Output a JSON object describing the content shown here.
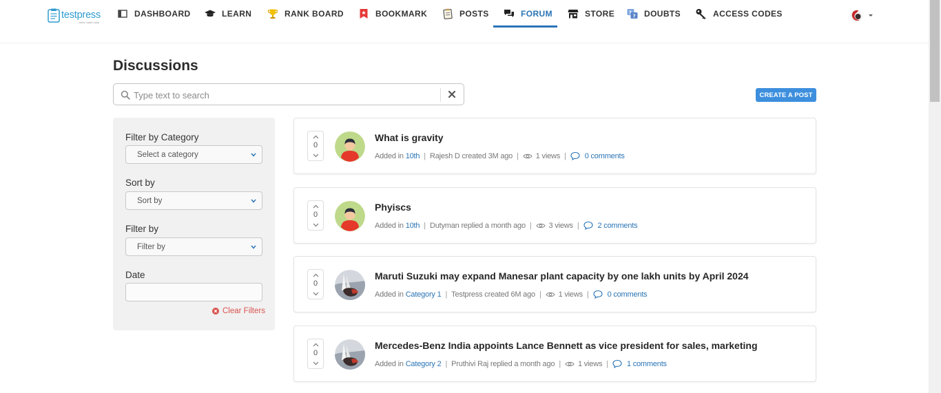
{
  "brand": {
    "name": "testpress",
    "tagline": "tests made easy"
  },
  "nav": {
    "items": [
      {
        "label": "DASHBOARD",
        "icon": "dashboard-icon"
      },
      {
        "label": "LEARN",
        "icon": "graduation-cap-icon"
      },
      {
        "label": "RANK BOARD",
        "icon": "trophy-icon"
      },
      {
        "label": "BOOKMARK",
        "icon": "bookmark-icon"
      },
      {
        "label": "POSTS",
        "icon": "posts-icon"
      },
      {
        "label": "FORUM",
        "icon": "forum-icon",
        "active": true
      },
      {
        "label": "STORE",
        "icon": "store-icon"
      },
      {
        "label": "DOUBTS",
        "icon": "doubts-icon"
      },
      {
        "label": "ACCESS CODES",
        "icon": "key-icon"
      }
    ],
    "active_color": "#2a74b5"
  },
  "page": {
    "title": "Discussions"
  },
  "search": {
    "placeholder": "Type text to search",
    "value": ""
  },
  "create_post": {
    "label": "CREATE A POST",
    "color": "#3d8fde"
  },
  "filters": {
    "category_label": "Filter by Category",
    "category_placeholder": "Select a category",
    "sort_label": "Sort by",
    "sort_placeholder": "Sort by",
    "filter_label": "Filter by",
    "filter_placeholder": "Filter by",
    "date_label": "Date",
    "date_value": "",
    "clear_label": "Clear Filters"
  },
  "posts": [
    {
      "title": "What is gravity",
      "votes": "0",
      "added_in": "Added in",
      "category": "10th",
      "activity": "Rajesh D created 3M ago",
      "views": "1 views",
      "comments": "0 comments",
      "avatar": "default-avatar"
    },
    {
      "title": "Phyiscs",
      "votes": "0",
      "added_in": "Added in",
      "category": "10th",
      "activity": "Dutyman replied a month ago",
      "views": "3 views",
      "comments": "2 comments",
      "avatar": "default-avatar"
    },
    {
      "title": "Maruti Suzuki may expand Manesar plant capacity by one lakh units by April 2024",
      "votes": "0",
      "added_in": "Added in",
      "category": "Category 1",
      "activity": "Testpress created 6M ago",
      "views": "1 views",
      "comments": "0 comments",
      "avatar": "photo-avatar"
    },
    {
      "title": "Mercedes-Benz India appoints Lance Bennett as vice president for sales, marketing",
      "votes": "0",
      "added_in": "Added in",
      "category": "Category 2",
      "activity": "Pruthivi Raj replied a month ago",
      "views": "1 views",
      "comments": "1 comments",
      "avatar": "photo-avatar"
    }
  ]
}
